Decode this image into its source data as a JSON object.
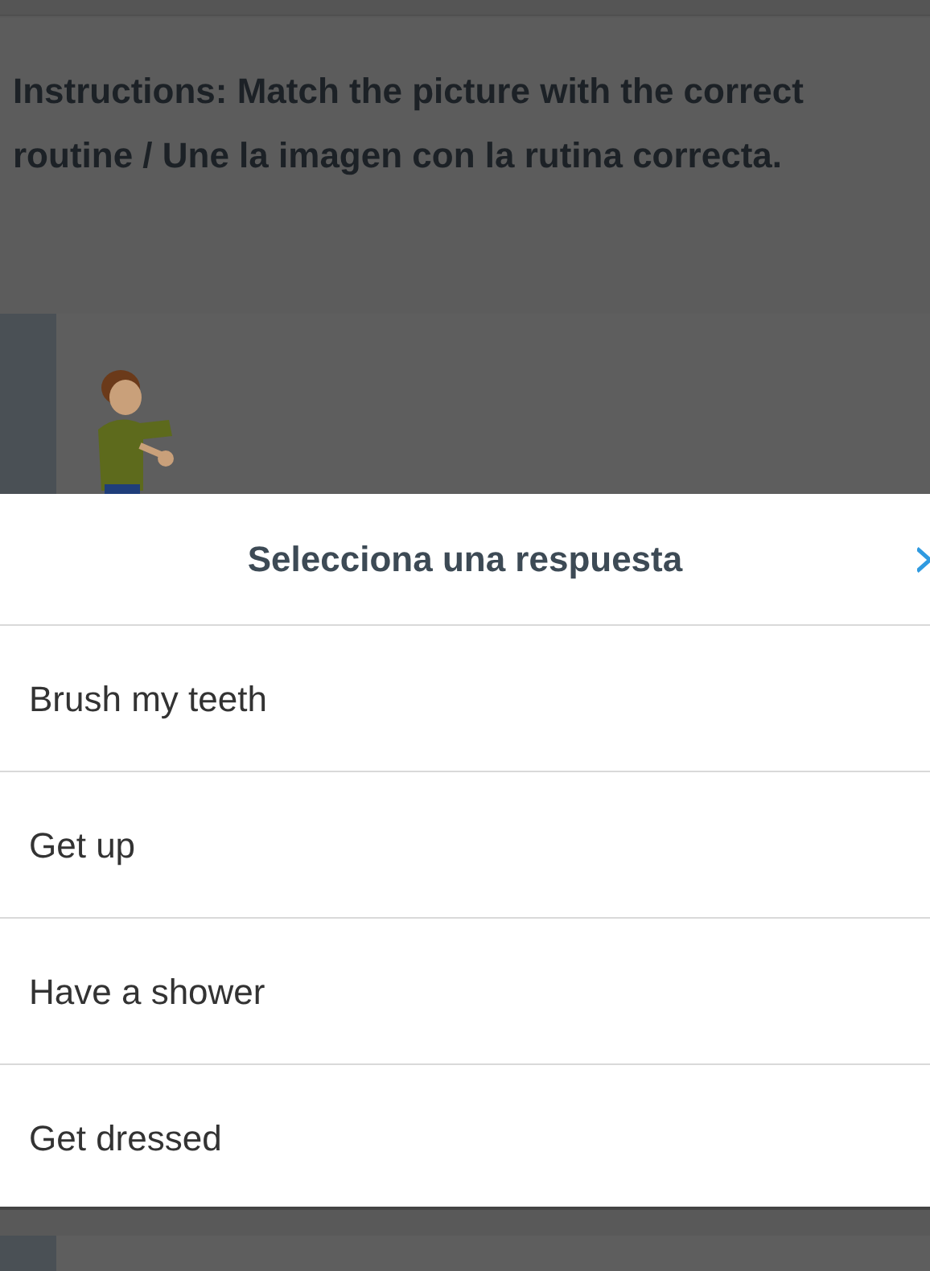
{
  "instructions": "Instructions: Match the picture with the correct routine / Une la imagen con la rutina correcta.",
  "answer_sheet": {
    "title": "Selecciona una respuesta",
    "options": [
      {
        "label": "Brush my teeth"
      },
      {
        "label": "Get up"
      },
      {
        "label": "Have a shower"
      },
      {
        "label": "Get dressed"
      }
    ]
  }
}
